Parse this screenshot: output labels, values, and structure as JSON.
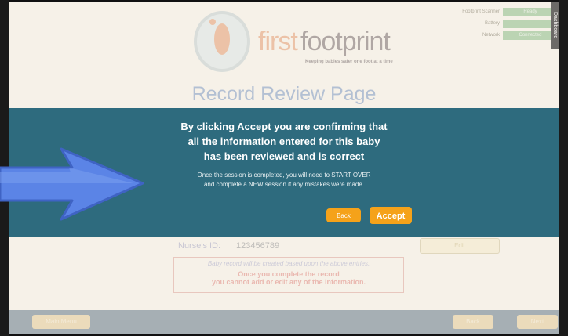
{
  "header": {
    "logo_first": "first",
    "logo_footprint": "footprint",
    "tagline": "Keeping babies safer one foot at a time",
    "side_tab": "Dashboard"
  },
  "status": [
    {
      "label": "Footprint Scanner",
      "value": "Ready"
    },
    {
      "label": "Battery",
      "value": ""
    },
    {
      "label": "Network",
      "value": "Connected"
    }
  ],
  "page_title": "Record Review Page",
  "form": {
    "nurse_label": "Nurse's ID:",
    "nurse_value": "123456789",
    "edit_label": "Edit",
    "note": "Baby record will be created based upon the above entries.",
    "warning_line1": "Once you complete the record",
    "warning_line2": "you cannot add or edit any of the information."
  },
  "bottom": {
    "main_menu": "Main Menu",
    "back": "Back",
    "next": "Next"
  },
  "modal": {
    "title_line1": "By clicking Accept you are confirming that",
    "title_line2": "all the information entered for this baby",
    "title_line3": "has been reviewed and is correct",
    "sub_line1": "Once the session is completed, you will need to START OVER",
    "sub_line2": "and complete a NEW session if any mistakes were made.",
    "back_label": "Back",
    "accept_label": "Accept"
  },
  "colors": {
    "modal_bg": "#2e6b7e",
    "button": "#f5a21a",
    "arrow": "#5b84e6"
  }
}
